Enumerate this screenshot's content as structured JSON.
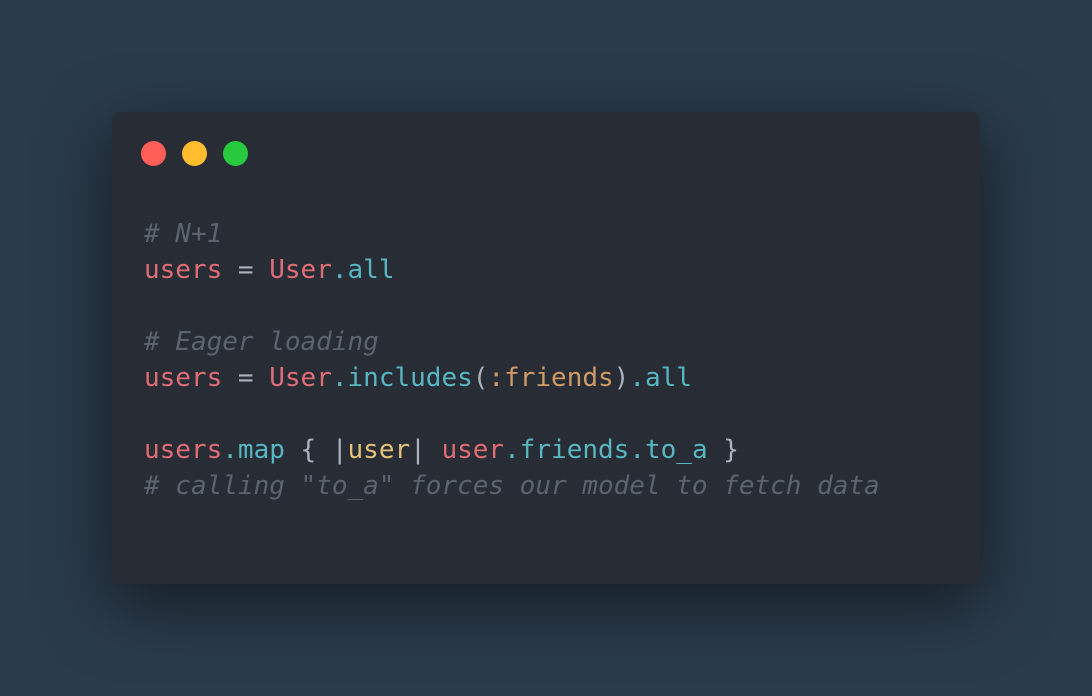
{
  "window": {
    "controls": [
      {
        "name": "close",
        "color": "#ff5f56"
      },
      {
        "name": "minimize",
        "color": "#ffbd2e"
      },
      {
        "name": "maximize",
        "color": "#27c93f"
      }
    ]
  },
  "code": {
    "lines": [
      {
        "tokens": [
          {
            "text": "# N+1",
            "type": "comment"
          }
        ]
      },
      {
        "tokens": [
          {
            "text": "users",
            "type": "var"
          },
          {
            "text": " = ",
            "type": "punct"
          },
          {
            "text": "User",
            "type": "const"
          },
          {
            "text": ".all",
            "type": "method"
          }
        ]
      },
      {
        "tokens": []
      },
      {
        "tokens": [
          {
            "text": "# Eager loading",
            "type": "comment"
          }
        ]
      },
      {
        "tokens": [
          {
            "text": "users",
            "type": "var"
          },
          {
            "text": " = ",
            "type": "punct"
          },
          {
            "text": "User",
            "type": "const"
          },
          {
            "text": ".includes",
            "type": "method"
          },
          {
            "text": "(",
            "type": "punct"
          },
          {
            "text": ":friends",
            "type": "sym"
          },
          {
            "text": ")",
            "type": "punct"
          },
          {
            "text": ".all",
            "type": "method"
          }
        ]
      },
      {
        "tokens": []
      },
      {
        "tokens": [
          {
            "text": "users",
            "type": "var"
          },
          {
            "text": ".map",
            "type": "method"
          },
          {
            "text": " { |",
            "type": "punct"
          },
          {
            "text": "user",
            "type": "param"
          },
          {
            "text": "| ",
            "type": "punct"
          },
          {
            "text": "user",
            "type": "var"
          },
          {
            "text": ".friends",
            "type": "method"
          },
          {
            "text": ".to_a",
            "type": "method"
          },
          {
            "text": " }",
            "type": "punct"
          }
        ]
      },
      {
        "tokens": [
          {
            "text": "# calling \"to_a\" forces our model to fetch data",
            "type": "comment"
          }
        ]
      }
    ]
  }
}
